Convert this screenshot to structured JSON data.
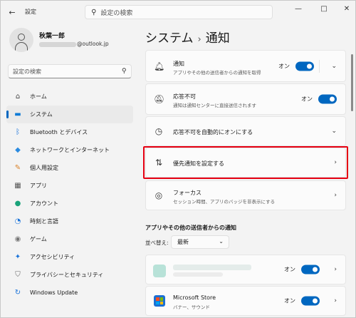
{
  "window": {
    "app_title": "設定",
    "back_icon": "back-arrow-icon",
    "search_placeholder": "設定の検索",
    "controls": {
      "minimize": "—",
      "maximize": "□",
      "close": "✕"
    }
  },
  "user": {
    "name": "秋葉一郎",
    "email_domain": "@outlook.jp"
  },
  "sidebar": {
    "search_placeholder": "設定の検索",
    "items": [
      {
        "label": "ホーム",
        "icon": "home-icon",
        "glyph": "⌂",
        "color": "#444444"
      },
      {
        "label": "システム",
        "icon": "monitor-icon",
        "glyph": "▬",
        "color": "#0a7ad6",
        "active": true
      },
      {
        "label": "Bluetooth とデバイス",
        "icon": "bluetooth-icon",
        "glyph": "ᛒ",
        "color": "#1a73d9"
      },
      {
        "label": "ネットワークとインターネット",
        "icon": "wifi-icon",
        "glyph": "◆",
        "color": "#2a8be0"
      },
      {
        "label": "個人用設定",
        "icon": "brush-icon",
        "glyph": "✎",
        "color": "#d9822b"
      },
      {
        "label": "アプリ",
        "icon": "apps-icon",
        "glyph": "▦",
        "color": "#555555"
      },
      {
        "label": "アカウント",
        "icon": "account-icon",
        "glyph": "●",
        "color": "#1aa37a"
      },
      {
        "label": "時刻と言語",
        "icon": "globe-clock-icon",
        "glyph": "◔",
        "color": "#1a73d9"
      },
      {
        "label": "ゲーム",
        "icon": "gamepad-icon",
        "glyph": "◉",
        "color": "#777777"
      },
      {
        "label": "アクセシビリティ",
        "icon": "accessibility-icon",
        "glyph": "✦",
        "color": "#1a73d9"
      },
      {
        "label": "プライバシーとセキュリティ",
        "icon": "shield-icon",
        "glyph": "⛉",
        "color": "#666666"
      },
      {
        "label": "Windows Update",
        "icon": "update-icon",
        "glyph": "↻",
        "color": "#1a73d9"
      }
    ]
  },
  "breadcrumb": {
    "parent": "システム",
    "separator": "›",
    "current": "通知"
  },
  "cards": {
    "notifications": {
      "title": "通知",
      "subtitle": "アプリやその他の送信者からの通知を取得",
      "toggle_label": "オン"
    },
    "dnd": {
      "title": "応答不可",
      "subtitle": "通知は通知センターに直接送信されます",
      "toggle_label": "オン"
    },
    "auto_dnd": {
      "title": "応答不可を自動的にオンにする"
    },
    "priority": {
      "title": "優先通知を設定する"
    },
    "focus": {
      "title": "フォーカス",
      "subtitle": "セッション時間、アプリのバッジを非表示にする"
    }
  },
  "apps_section": {
    "title": "アプリやその他の送信者からの通知",
    "sort_label": "並べ替え:",
    "sort_value": "最新",
    "apps": [
      {
        "toggle_label": "オン"
      },
      {
        "title": "Microsoft Store",
        "subtitle": "バナー、サウンド",
        "toggle_label": "オン"
      }
    ]
  },
  "colors": {
    "accent": "#0067c0",
    "highlight": "#e60012"
  }
}
